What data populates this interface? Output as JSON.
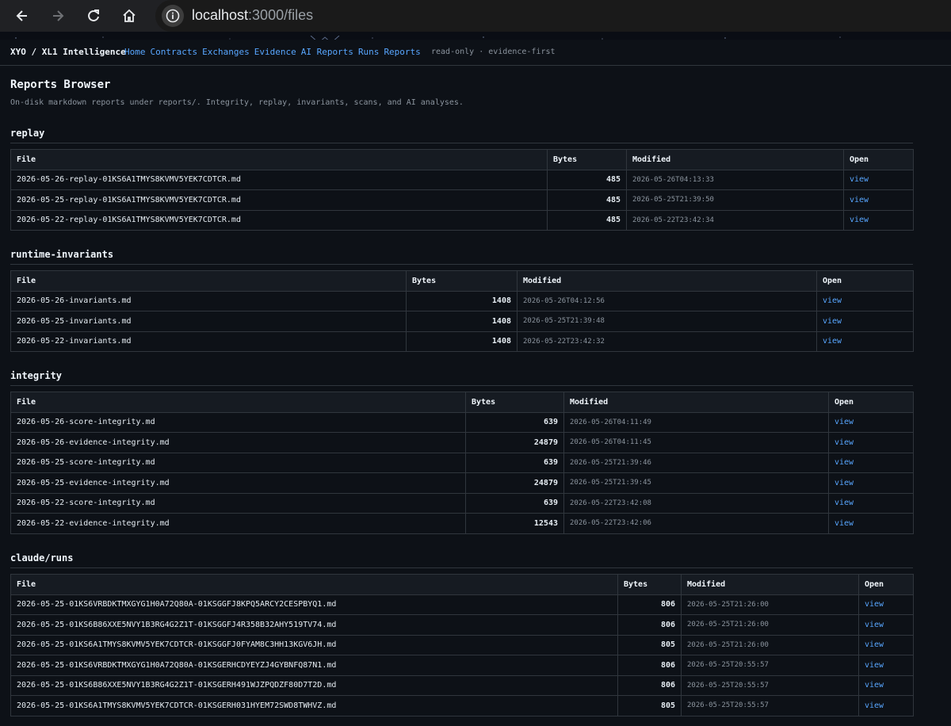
{
  "browser": {
    "url_host": "localhost",
    "url_rest": ":3000/files"
  },
  "nav": {
    "brand": "XYO / XL1 Intelligence",
    "links": [
      "Home",
      "Contracts",
      "Exchanges",
      "Evidence",
      "AI Reports",
      "Runs",
      "Reports"
    ],
    "tagline": "read-only · evidence-first"
  },
  "page": {
    "title": "Reports Browser",
    "subtitle": "On-disk markdown reports under reports/. Integrity, replay, invariants, scans, and AI analyses."
  },
  "columns": {
    "file": "File",
    "bytes": "Bytes",
    "modified": "Modified",
    "open": "Open"
  },
  "sections": [
    {
      "title": "replay",
      "rows": [
        {
          "file": "2026-05-26-replay-01KS6A1TMYS8KVMV5YEK7CDTCR.md",
          "bytes": "485",
          "modified": "2026-05-26T04:13:33",
          "open": "view"
        },
        {
          "file": "2026-05-25-replay-01KS6A1TMYS8KVMV5YEK7CDTCR.md",
          "bytes": "485",
          "modified": "2026-05-25T21:39:50",
          "open": "view"
        },
        {
          "file": "2026-05-22-replay-01KS6A1TMYS8KVMV5YEK7CDTCR.md",
          "bytes": "485",
          "modified": "2026-05-22T23:42:34",
          "open": "view"
        }
      ]
    },
    {
      "title": "runtime-invariants",
      "rows": [
        {
          "file": "2026-05-26-invariants.md",
          "bytes": "1408",
          "modified": "2026-05-26T04:12:56",
          "open": "view"
        },
        {
          "file": "2026-05-25-invariants.md",
          "bytes": "1408",
          "modified": "2026-05-25T21:39:48",
          "open": "view"
        },
        {
          "file": "2026-05-22-invariants.md",
          "bytes": "1408",
          "modified": "2026-05-22T23:42:32",
          "open": "view"
        }
      ]
    },
    {
      "title": "integrity",
      "rows": [
        {
          "file": "2026-05-26-score-integrity.md",
          "bytes": "639",
          "modified": "2026-05-26T04:11:49",
          "open": "view"
        },
        {
          "file": "2026-05-26-evidence-integrity.md",
          "bytes": "24879",
          "modified": "2026-05-26T04:11:45",
          "open": "view"
        },
        {
          "file": "2026-05-25-score-integrity.md",
          "bytes": "639",
          "modified": "2026-05-25T21:39:46",
          "open": "view"
        },
        {
          "file": "2026-05-25-evidence-integrity.md",
          "bytes": "24879",
          "modified": "2026-05-25T21:39:45",
          "open": "view"
        },
        {
          "file": "2026-05-22-score-integrity.md",
          "bytes": "639",
          "modified": "2026-05-22T23:42:08",
          "open": "view"
        },
        {
          "file": "2026-05-22-evidence-integrity.md",
          "bytes": "12543",
          "modified": "2026-05-22T23:42:06",
          "open": "view"
        }
      ]
    },
    {
      "title": "claude/runs",
      "rows": [
        {
          "file": "2026-05-25-01KS6VRBDKTMXGYG1H0A72Q80A-01KSGGFJ8KPQ5ARCY2CESPBYQ1.md",
          "bytes": "806",
          "modified": "2026-05-25T21:26:00",
          "open": "view"
        },
        {
          "file": "2026-05-25-01KS6B86XXE5NVY1B3RG4G2Z1T-01KSGGFJ4R358B32AHY519TV74.md",
          "bytes": "806",
          "modified": "2026-05-25T21:26:00",
          "open": "view"
        },
        {
          "file": "2026-05-25-01KS6A1TMYS8KVMV5YEK7CDTCR-01KSGGFJ0FYAM8C3HH13KGV6JH.md",
          "bytes": "805",
          "modified": "2026-05-25T21:26:00",
          "open": "view"
        },
        {
          "file": "2026-05-25-01KS6VRBDKTMXGYG1H0A72Q80A-01KSGERHCDYEYZJ4GYBNFQ87N1.md",
          "bytes": "806",
          "modified": "2026-05-25T20:55:57",
          "open": "view"
        },
        {
          "file": "2026-05-25-01KS6B86XXE5NVY1B3RG4G2Z1T-01KSGERH491WJZPQDZF80D7T2D.md",
          "bytes": "806",
          "modified": "2026-05-25T20:55:57",
          "open": "view"
        },
        {
          "file": "2026-05-25-01KS6A1TMYS8KVMV5YEK7CDTCR-01KSGERH031HYEM72SWD8TWHVZ.md",
          "bytes": "805",
          "modified": "2026-05-25T20:55:57",
          "open": "view"
        }
      ]
    }
  ]
}
